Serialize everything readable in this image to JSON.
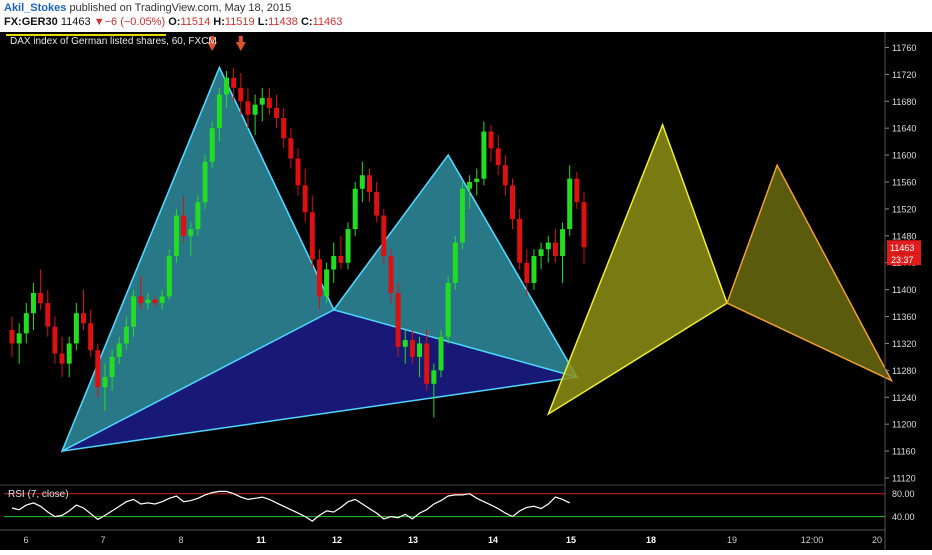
{
  "header": {
    "author": "Akil_Stokes",
    "published": "published on TradingView.com, May 18, 2015",
    "symbol": "FX:GER30",
    "last": "11463",
    "change": "▼−6 (−0.05%)",
    "o_label": "O:",
    "o_value": "11514",
    "h_label": "H:",
    "h_value": "11519",
    "l_label": "L:",
    "l_value": "11438",
    "c_label": "C:",
    "c_value": "11463"
  },
  "chart": {
    "description": "DAX index of German listed shares, 60, FXCM",
    "price_badge": "11463",
    "timer_badge": "23:37",
    "rsi_label": "RSI (7, close)"
  },
  "colors": {
    "background": "#000000",
    "bull": "#22dd22",
    "bear": "#dd1111",
    "pattern_blue_fill": "#1c1c8c",
    "pattern_teal_fill": "#2b8a8a",
    "pattern_yellow_fill": "#8f8f16",
    "pattern_orange_fill": "#6b6b10",
    "line_cyan": "#4fd8ff",
    "line_yellow": "#eeee33",
    "line_orange": "#f0a030",
    "arrow": "#e05030",
    "rsi_line": "#ffffff",
    "rsi_upper": "#cc2222",
    "rsi_lower": "#22cc22",
    "badge": "#e31b1b"
  },
  "chart_data": {
    "type": "candlestick",
    "price_axis": [
      "11760",
      "11720",
      "11680",
      "11640",
      "11600",
      "11560",
      "11520",
      "11480",
      "11440",
      "11400",
      "11360",
      "11320",
      "11280",
      "11240",
      "11200",
      "11160",
      "11120"
    ],
    "ylim": [
      11120,
      11780
    ],
    "time_axis": [
      "6",
      "7",
      "8",
      "11",
      "12",
      "13",
      "14",
      "15",
      "18",
      "19",
      "12:00",
      "20"
    ],
    "rsi_axis": [
      "80.00",
      "40.00"
    ],
    "rsi_levels": [
      80,
      40
    ],
    "candles": [
      {
        "o": 11340,
        "h": 11360,
        "l": 11300,
        "c": 11320
      },
      {
        "o": 11320,
        "h": 11350,
        "l": 11290,
        "c": 11335
      },
      {
        "o": 11335,
        "h": 11380,
        "l": 11320,
        "c": 11365
      },
      {
        "o": 11365,
        "h": 11410,
        "l": 11340,
        "c": 11395
      },
      {
        "o": 11395,
        "h": 11430,
        "l": 11370,
        "c": 11380
      },
      {
        "o": 11380,
        "h": 11400,
        "l": 11330,
        "c": 11345
      },
      {
        "o": 11345,
        "h": 11360,
        "l": 11290,
        "c": 11305
      },
      {
        "o": 11305,
        "h": 11330,
        "l": 11270,
        "c": 11290
      },
      {
        "o": 11290,
        "h": 11330,
        "l": 11270,
        "c": 11320
      },
      {
        "o": 11320,
        "h": 11380,
        "l": 11310,
        "c": 11365
      },
      {
        "o": 11365,
        "h": 11400,
        "l": 11340,
        "c": 11350
      },
      {
        "o": 11350,
        "h": 11370,
        "l": 11300,
        "c": 11310
      },
      {
        "o": 11310,
        "h": 11320,
        "l": 11240,
        "c": 11255
      },
      {
        "o": 11255,
        "h": 11290,
        "l": 11220,
        "c": 11270
      },
      {
        "o": 11270,
        "h": 11310,
        "l": 11250,
        "c": 11300
      },
      {
        "o": 11300,
        "h": 11330,
        "l": 11290,
        "c": 11320
      },
      {
        "o": 11320,
        "h": 11360,
        "l": 11310,
        "c": 11345
      },
      {
        "o": 11345,
        "h": 11400,
        "l": 11330,
        "c": 11390
      },
      {
        "o": 11390,
        "h": 11420,
        "l": 11370,
        "c": 11380
      },
      {
        "o": 11380,
        "h": 11395,
        "l": 11370,
        "c": 11385
      },
      {
        "o": 11385,
        "h": 11390,
        "l": 11375,
        "c": 11380
      },
      {
        "o": 11380,
        "h": 11400,
        "l": 11370,
        "c": 11390
      },
      {
        "o": 11390,
        "h": 11460,
        "l": 11385,
        "c": 11450
      },
      {
        "o": 11450,
        "h": 11520,
        "l": 11440,
        "c": 11510
      },
      {
        "o": 11510,
        "h": 11540,
        "l": 11470,
        "c": 11480
      },
      {
        "o": 11480,
        "h": 11500,
        "l": 11450,
        "c": 11490
      },
      {
        "o": 11490,
        "h": 11540,
        "l": 11480,
        "c": 11530
      },
      {
        "o": 11530,
        "h": 11600,
        "l": 11520,
        "c": 11590
      },
      {
        "o": 11590,
        "h": 11650,
        "l": 11580,
        "c": 11640
      },
      {
        "o": 11640,
        "h": 11700,
        "l": 11620,
        "c": 11690
      },
      {
        "o": 11690,
        "h": 11725,
        "l": 11670,
        "c": 11715
      },
      {
        "o": 11715,
        "h": 11730,
        "l": 11680,
        "c": 11700
      },
      {
        "o": 11700,
        "h": 11722,
        "l": 11660,
        "c": 11680
      },
      {
        "o": 11680,
        "h": 11700,
        "l": 11640,
        "c": 11660
      },
      {
        "o": 11660,
        "h": 11690,
        "l": 11630,
        "c": 11675
      },
      {
        "o": 11675,
        "h": 11700,
        "l": 11650,
        "c": 11685
      },
      {
        "o": 11685,
        "h": 11700,
        "l": 11660,
        "c": 11670
      },
      {
        "o": 11670,
        "h": 11690,
        "l": 11640,
        "c": 11655
      },
      {
        "o": 11655,
        "h": 11670,
        "l": 11610,
        "c": 11625
      },
      {
        "o": 11625,
        "h": 11640,
        "l": 11580,
        "c": 11595
      },
      {
        "o": 11595,
        "h": 11610,
        "l": 11540,
        "c": 11555
      },
      {
        "o": 11555,
        "h": 11580,
        "l": 11500,
        "c": 11515
      },
      {
        "o": 11515,
        "h": 11540,
        "l": 11430,
        "c": 11445
      },
      {
        "o": 11445,
        "h": 11460,
        "l": 11370,
        "c": 11390
      },
      {
        "o": 11390,
        "h": 11440,
        "l": 11380,
        "c": 11430
      },
      {
        "o": 11430,
        "h": 11470,
        "l": 11410,
        "c": 11450
      },
      {
        "o": 11450,
        "h": 11480,
        "l": 11430,
        "c": 11440
      },
      {
        "o": 11440,
        "h": 11500,
        "l": 11430,
        "c": 11490
      },
      {
        "o": 11490,
        "h": 11560,
        "l": 11480,
        "c": 11550
      },
      {
        "o": 11550,
        "h": 11590,
        "l": 11530,
        "c": 11570
      },
      {
        "o": 11570,
        "h": 11580,
        "l": 11530,
        "c": 11545
      },
      {
        "o": 11545,
        "h": 11560,
        "l": 11500,
        "c": 11510
      },
      {
        "o": 11510,
        "h": 11520,
        "l": 11440,
        "c": 11450
      },
      {
        "o": 11450,
        "h": 11460,
        "l": 11380,
        "c": 11395
      },
      {
        "o": 11395,
        "h": 11410,
        "l": 11300,
        "c": 11315
      },
      {
        "o": 11315,
        "h": 11340,
        "l": 11290,
        "c": 11325
      },
      {
        "o": 11325,
        "h": 11340,
        "l": 11290,
        "c": 11300
      },
      {
        "o": 11300,
        "h": 11330,
        "l": 11270,
        "c": 11320
      },
      {
        "o": 11320,
        "h": 11340,
        "l": 11250,
        "c": 11260
      },
      {
        "o": 11260,
        "h": 11290,
        "l": 11210,
        "c": 11280
      },
      {
        "o": 11280,
        "h": 11340,
        "l": 11270,
        "c": 11330
      },
      {
        "o": 11330,
        "h": 11420,
        "l": 11320,
        "c": 11410
      },
      {
        "o": 11410,
        "h": 11480,
        "l": 11400,
        "c": 11470
      },
      {
        "o": 11470,
        "h": 11560,
        "l": 11460,
        "c": 11550
      },
      {
        "o": 11550,
        "h": 11570,
        "l": 11520,
        "c": 11560
      },
      {
        "o": 11560,
        "h": 11580,
        "l": 11540,
        "c": 11565
      },
      {
        "o": 11565,
        "h": 11650,
        "l": 11555,
        "c": 11635
      },
      {
        "o": 11635,
        "h": 11645,
        "l": 11590,
        "c": 11610
      },
      {
        "o": 11610,
        "h": 11630,
        "l": 11570,
        "c": 11585
      },
      {
        "o": 11585,
        "h": 11600,
        "l": 11540,
        "c": 11555
      },
      {
        "o": 11555,
        "h": 11565,
        "l": 11490,
        "c": 11505
      },
      {
        "o": 11505,
        "h": 11520,
        "l": 11430,
        "c": 11440
      },
      {
        "o": 11440,
        "h": 11460,
        "l": 11390,
        "c": 11410
      },
      {
        "o": 11410,
        "h": 11460,
        "l": 11400,
        "c": 11450
      },
      {
        "o": 11450,
        "h": 11470,
        "l": 11430,
        "c": 11460
      },
      {
        "o": 11460,
        "h": 11480,
        "l": 11440,
        "c": 11470
      },
      {
        "o": 11470,
        "h": 11490,
        "l": 11440,
        "c": 11450
      },
      {
        "o": 11450,
        "h": 11500,
        "l": 11410,
        "c": 11490
      },
      {
        "o": 11490,
        "h": 11585,
        "l": 11480,
        "c": 11565
      },
      {
        "o": 11565,
        "h": 11575,
        "l": 11520,
        "c": 11530
      },
      {
        "o": 11530,
        "h": 11545,
        "l": 11438,
        "c": 11463
      }
    ],
    "rsi": [
      55,
      52,
      60,
      64,
      58,
      48,
      40,
      42,
      50,
      60,
      55,
      45,
      35,
      42,
      50,
      58,
      66,
      70,
      62,
      64,
      62,
      66,
      72,
      76,
      66,
      68,
      72,
      78,
      82,
      84,
      84,
      80,
      74,
      70,
      72,
      74,
      70,
      64,
      58,
      52,
      46,
      40,
      32,
      42,
      50,
      48,
      56,
      66,
      70,
      62,
      54,
      46,
      36,
      40,
      38,
      44,
      36,
      46,
      52,
      62,
      68,
      76,
      78,
      78,
      80,
      72,
      66,
      60,
      54,
      46,
      40,
      50,
      56,
      58,
      54,
      62,
      74,
      70,
      64
    ],
    "patterns": [
      {
        "name": "blue-bat-outer",
        "points": [
          [
            7,
            11160
          ],
          [
            29,
            11730
          ],
          [
            45,
            11370
          ],
          [
            61,
            11600
          ],
          [
            79,
            11270
          ]
        ],
        "fill": "pattern_blue_fill",
        "stroke": "line_cyan"
      },
      {
        "name": "teal-triangle-1",
        "points": [
          [
            7,
            11160
          ],
          [
            29,
            11730
          ],
          [
            45,
            11370
          ]
        ],
        "fill": "pattern_teal_fill",
        "stroke": "line_cyan"
      },
      {
        "name": "teal-triangle-2",
        "points": [
          [
            45,
            11370
          ],
          [
            61,
            11600
          ],
          [
            79,
            11270
          ]
        ],
        "fill": "pattern_teal_fill",
        "stroke": "line_cyan"
      },
      {
        "name": "yellow-pattern",
        "points": [
          [
            75,
            11215
          ],
          [
            91,
            11645
          ],
          [
            100,
            11380
          ]
        ],
        "fill": "pattern_yellow_fill",
        "stroke": "line_yellow"
      },
      {
        "name": "orange-pattern",
        "points": [
          [
            100,
            11380
          ],
          [
            107,
            11585
          ],
          [
            123,
            11265
          ]
        ],
        "fill": "pattern_orange_fill",
        "stroke": "line_orange"
      }
    ],
    "annotation_arrows": [
      28,
      32
    ]
  }
}
